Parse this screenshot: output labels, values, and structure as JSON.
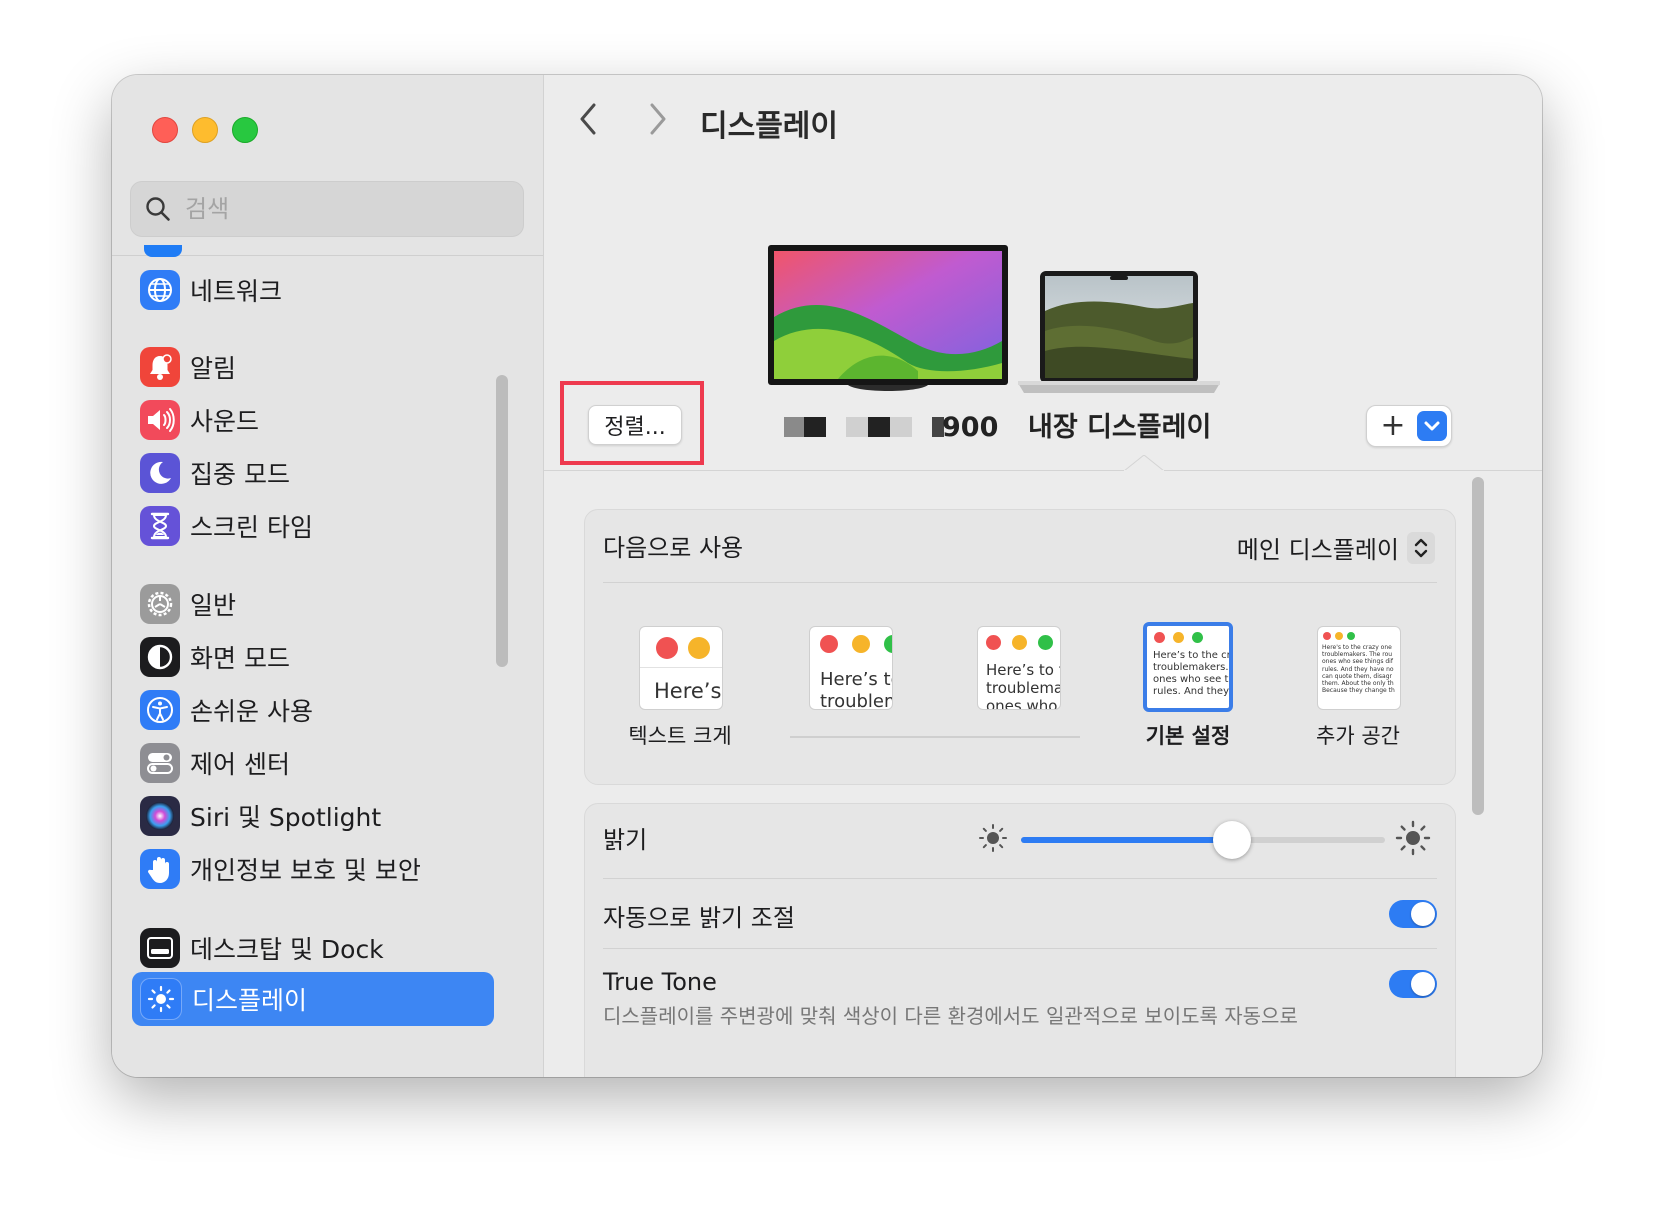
{
  "sidebar": {
    "search_placeholder": "검색",
    "items": [
      {
        "label": "네트워크",
        "icon": "globe-icon",
        "color": "#2f7cf6"
      },
      {
        "label": "알림",
        "icon": "bell-icon",
        "color": "#f0453a"
      },
      {
        "label": "사운드",
        "icon": "speaker-icon",
        "color": "#f24a5b"
      },
      {
        "label": "집중 모드",
        "icon": "moon-icon",
        "color": "#5b54d6"
      },
      {
        "label": "스크린 타임",
        "icon": "hourglass-icon",
        "color": "#6552d8"
      },
      {
        "label": "일반",
        "icon": "gear-icon",
        "color": "#9b9b9b"
      },
      {
        "label": "화면 모드",
        "icon": "appearance-icon",
        "color": "#1c1c1e"
      },
      {
        "label": "손쉬운 사용",
        "icon": "accessibility-icon",
        "color": "#2f7cf6"
      },
      {
        "label": "제어 센터",
        "icon": "control-center-icon",
        "color": "#8e8e93"
      },
      {
        "label": "Siri 및 Spotlight",
        "icon": "siri-icon",
        "color": "#2a2a44"
      },
      {
        "label": "개인정보 보호 및 보안",
        "icon": "hand-icon",
        "color": "#2f7cf6"
      },
      {
        "label": "데스크탑 및 Dock",
        "icon": "dock-icon",
        "color": "#1c1c1e"
      },
      {
        "label": "디스플레이",
        "icon": "sun-icon",
        "color": "#2f7cf6"
      }
    ]
  },
  "header": {
    "title": "디스플레이"
  },
  "displays": {
    "arrange_button": "정렬...",
    "external_label_suffix": "900",
    "builtin_label": "내장 디스플레이",
    "add_button": "+"
  },
  "use_as": {
    "label": "다음으로 사용",
    "value": "메인 디스플레이"
  },
  "resolution": {
    "options": [
      {
        "label": "텍스트 크게",
        "preview": "Here’s"
      },
      {
        "label": "",
        "preview": "Here’s to\ntroublem"
      },
      {
        "label": "",
        "preview": "Here’s to t\ntroublema\nones who"
      },
      {
        "label": "기본 설정",
        "preview": "Here’s to the cr\ntroublemakers.\nones who see t\nrules. And they"
      },
      {
        "label": "추가 공간",
        "preview": "Here's to the crazy one\ntroublemakers. The rou\nones who see things dif\nrules. And they have no\ncan quote them, disagr\nthem. About the only th\nBecause they change th"
      }
    ],
    "selected_index": 3
  },
  "brightness": {
    "label": "밝기",
    "level": 0.58
  },
  "auto_brightness": {
    "label": "자동으로 밝기 조절",
    "on": true
  },
  "true_tone": {
    "label": "True Tone",
    "description": "디스플레이를 주변광에 맞춰 색상이 다른 환경에서도 일관적으로 보이도록 자동으로",
    "on": true
  },
  "colors": {
    "accent": "#2d7cf3",
    "highlight": "#ee3a4f"
  }
}
